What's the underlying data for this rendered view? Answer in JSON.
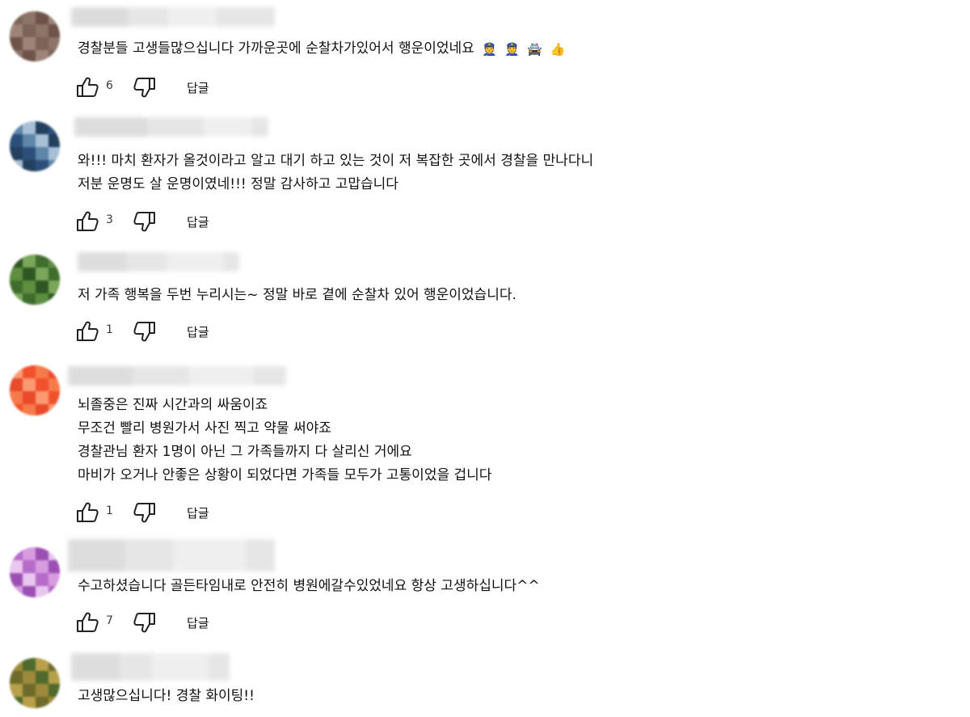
{
  "reply_label": "답글",
  "comments": [
    {
      "lines": [
        "경찰분들 고생들많으십니다  가까운곳에 순찰차가있어서 행운이었네요"
      ],
      "emojis": [
        "👮",
        "👮",
        "🚔",
        "👍"
      ],
      "likes": "6",
      "avatar_colors": [
        "#7a6459",
        "#8c7469",
        "#6d5349",
        "#9c8478"
      ]
    },
    {
      "lines": [
        "와!!! 마치 환자가 올것이라고 알고 대기 하고 있는 것이 저 복잡한 곳에서 경찰을 만나다니",
        "저분 운명도 살 운명이였네!!! 정말 감사하고 고맙습니다"
      ],
      "emojis": [],
      "likes": "3",
      "avatar_colors": [
        "#2c4f7a",
        "#5d86a8",
        "#a7c0d6",
        "#23405f"
      ]
    },
    {
      "lines": [
        "저 가족 행복을 두번 누리시는~ 정말 바로 곁에 순찰차 있어 행운이었습니다."
      ],
      "emojis": [],
      "likes": "1",
      "avatar_colors": [
        "#3f6e2c",
        "#5e8f40",
        "#2f5622",
        "#7aa65a"
      ]
    },
    {
      "lines": [
        "뇌졸중은 진짜 시간과의 싸움이죠",
        "무조건 빨리 병원가서 사진 찍고 약물 써야죠",
        "경찰관님 환자 1명이 아닌 그 가족들까지 다 살리신 거에요",
        "마비가 오거나 안좋은 상황이 되었다면 가족들 모두가 고통이었을 겁니다"
      ],
      "emojis": [],
      "likes": "1",
      "avatar_colors": [
        "#f0522d",
        "#f77a4a",
        "#e84a2a",
        "#fb9a72"
      ]
    },
    {
      "lines": [
        "수고하셨습니다 골든타임내로 안전히 병원에갈수있었네요 항상 고생하십니다^^"
      ],
      "emojis": [],
      "likes": "7",
      "avatar_colors": [
        "#b56bc7",
        "#d79be0",
        "#9c4fb3",
        "#e9c6ef"
      ]
    },
    {
      "lines": [
        "고생많으십니다! 경찰 화이팅!!"
      ],
      "emojis": [],
      "likes": "",
      "avatar_colors": [
        "#6e6a2a",
        "#9c8a3a",
        "#4f6a2c",
        "#b8a04a"
      ]
    }
  ]
}
